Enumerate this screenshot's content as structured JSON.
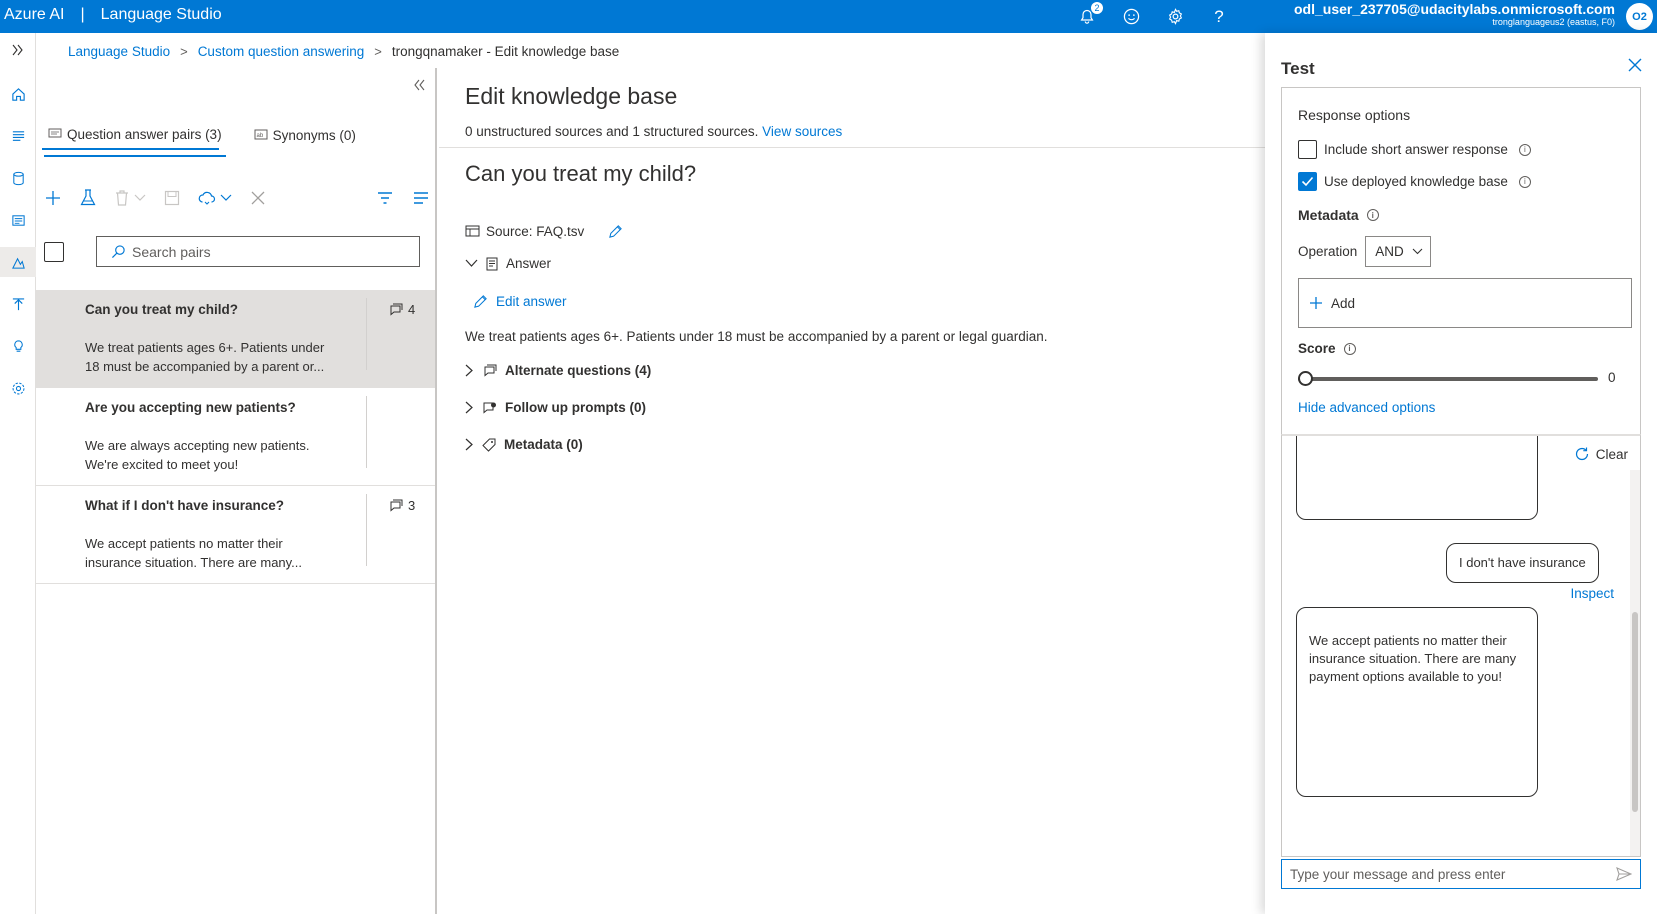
{
  "topbar": {
    "brand": "Azure AI",
    "separator": "|",
    "app": "Language Studio",
    "notification_count": "2",
    "user_email": "odl_user_237705@udacitylabs.onmicrosoft.com",
    "resource": "tronglanguageus2 (eastus, F0)",
    "avatar_initials": "O2",
    "help": "?"
  },
  "breadcrumb": {
    "items": [
      "Language Studio",
      "Custom question answering",
      "trongqnamaker - Edit knowledge base"
    ]
  },
  "list_pane": {
    "tabs": [
      {
        "label": "Question answer pairs (3)"
      },
      {
        "label": "Synonyms (0)"
      }
    ],
    "search_placeholder": "Search pairs",
    "items": [
      {
        "question": "Can you treat my child?",
        "answer_l1": "We treat patients ages 6+. Patients under",
        "answer_l2": "18 must be accompanied by a parent or...",
        "count": "4"
      },
      {
        "question": "Are you accepting new patients?",
        "answer_l1": "We are always accepting new patients.",
        "answer_l2": "We're excited to meet you!",
        "count": ""
      },
      {
        "question": "What if I don't have insurance?",
        "answer_l1": "We accept patients no matter their",
        "answer_l2": "insurance situation. There are many...",
        "count": "3"
      }
    ]
  },
  "editor": {
    "title": "Edit knowledge base",
    "sources_text": "0 unstructured sources and 1 structured sources.",
    "view_sources": "View sources",
    "question_title": "Can you treat my child?",
    "source_label": "Source: FAQ.tsv",
    "answer_label": "Answer",
    "edit_answer": "Edit answer",
    "answer_text": "We treat patients ages 6+. Patients under 18 must be accompanied by a parent or legal guardian.",
    "alternate_questions": "Alternate questions (4)",
    "follow_up_prompts": "Follow up prompts (0)",
    "metadata": "Metadata (0)"
  },
  "test_panel": {
    "title": "Test",
    "response_options": "Response options",
    "short_answer": "Include short answer response",
    "short_answer_checked": false,
    "use_deployed": "Use deployed knowledge base",
    "use_deployed_checked": true,
    "metadata_label": "Metadata",
    "operation_label": "Operation",
    "operation_value": "AND",
    "add_label": "Add",
    "score_label": "Score",
    "score_value": "0",
    "hide_advanced": "Hide advanced options",
    "clear": "Clear",
    "user_message": "I don't have insurance",
    "inspect": "Inspect",
    "bot_reply": "We accept patients no matter their insurance situation. There are many payment options available to you!",
    "input_placeholder": "Type your message and press enter"
  }
}
